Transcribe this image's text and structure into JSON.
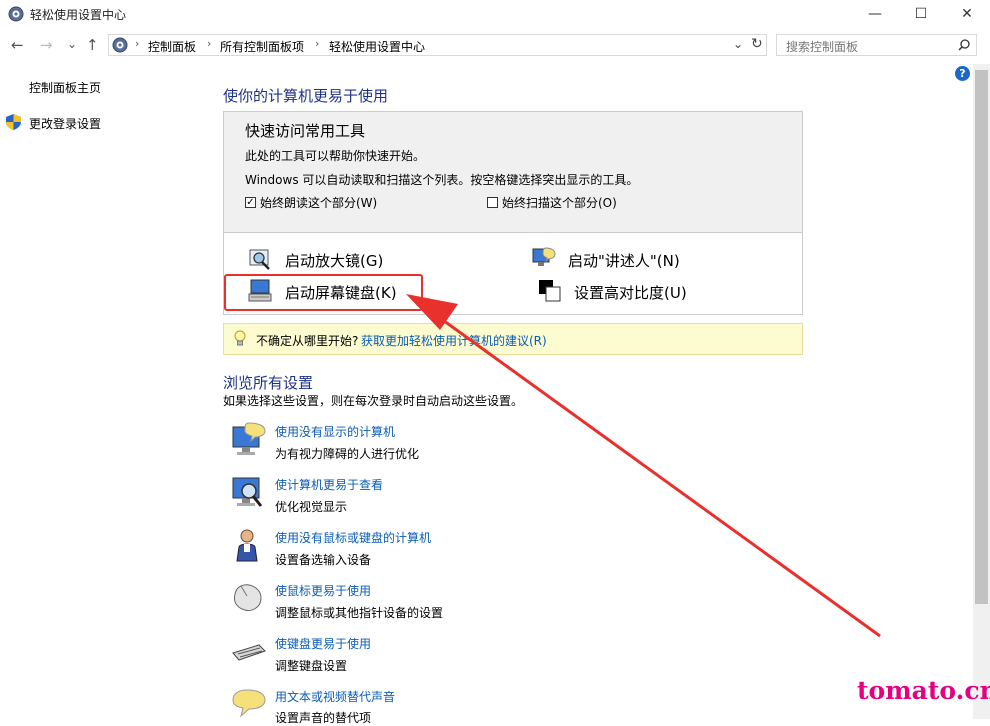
{
  "window": {
    "title": "轻松使用设置中心",
    "minimize_glyph": "—",
    "maximize_glyph": "☐",
    "close_glyph": "✕"
  },
  "nav": {
    "back_glyph": "←",
    "forward_glyph": "→",
    "recent_glyph": "⌄",
    "up_glyph": "↑",
    "refresh_glyph": "↻",
    "dropdown_glyph": "⌄"
  },
  "breadcrumb": [
    "控制面板",
    "所有控制面板项",
    "轻松使用设置中心"
  ],
  "search": {
    "placeholder": "搜索控制面板"
  },
  "sidebar": {
    "home": "控制面板主页",
    "change_login": "更改登录设置"
  },
  "main": {
    "heading": "使你的计算机更易于使用",
    "quick_access": {
      "title": "快速访问常用工具",
      "line1": "此处的工具可以帮助你快速开始。",
      "line2": "Windows 可以自动读取和扫描这个列表。按空格键选择突出显示的工具。",
      "checkbox_read": {
        "label": "始终朗读这个部分(W)",
        "checked": true
      },
      "checkbox_scan": {
        "label": "始终扫描这个部分(O)",
        "checked": false
      },
      "tools": {
        "magnifier": "启动放大镜(G)",
        "narrator": "启动\"讲述人\"(N)",
        "osk": "启动屏幕键盘(K)",
        "contrast": "设置高对比度(U)"
      }
    },
    "tip": {
      "prefix": "不确定从哪里开始?",
      "link": "获取更加轻松使用计算机的建议(R)"
    },
    "browse_heading": "浏览所有设置",
    "browse_desc": "如果选择这些设置，则在每次登录时自动启动这些设置。",
    "categories": [
      {
        "link": "使用没有显示的计算机",
        "sub": "为有视力障碍的人进行优化",
        "icon": "monitor-speech-icon"
      },
      {
        "link": "使计算机更易于查看",
        "sub": "优化视觉显示",
        "icon": "monitor-magnifier-icon"
      },
      {
        "link": "使用没有鼠标或键盘的计算机",
        "sub": "设置备选输入设备",
        "icon": "person-icon"
      },
      {
        "link": "使鼠标更易于使用",
        "sub": "调整鼠标或其他指针设备的设置",
        "icon": "mouse-icon"
      },
      {
        "link": "使键盘更易于使用",
        "sub": "调整键盘设置",
        "icon": "keyboard-icon"
      },
      {
        "link": "用文本或视频替代声音",
        "sub": "设置声音的替代项",
        "icon": "speech-bubble-icon"
      }
    ]
  },
  "help_glyph": "?",
  "watermark": "tomato.cm",
  "colors": {
    "link": "#0b5cb5",
    "heading": "#1e3287",
    "highlight_box": "#e8312c",
    "arrow": "#e8312c",
    "watermark": "#e5007f",
    "tip_bg": "#fdfbd0"
  }
}
